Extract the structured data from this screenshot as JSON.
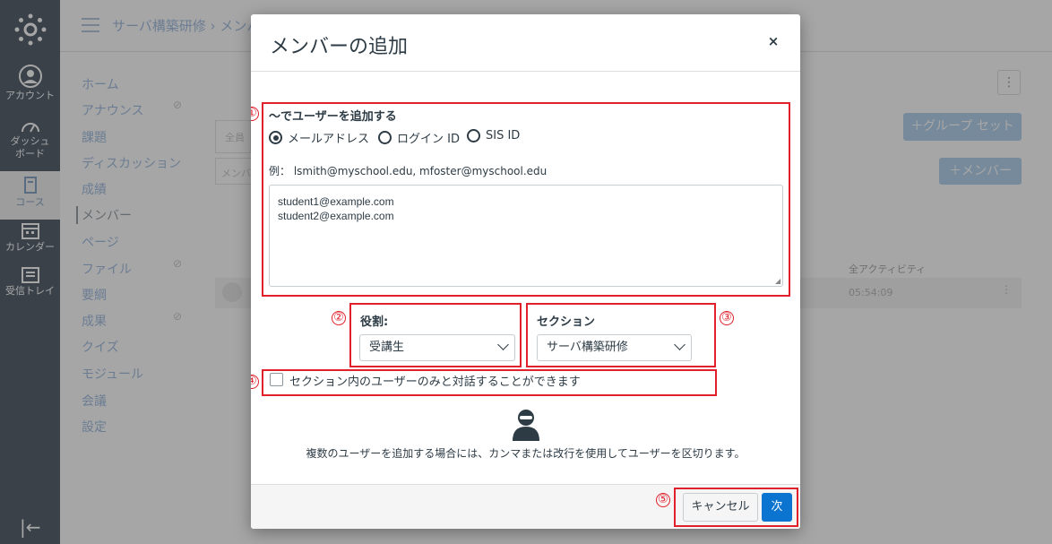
{
  "global_nav": {
    "items": [
      {
        "label": "アカウント",
        "icon": "user-avatar-icon"
      },
      {
        "label": "ダッシュボード",
        "icon": "dashboard-gauge-icon"
      },
      {
        "label": "コース",
        "icon": "book-icon"
      },
      {
        "label": "カレンダー",
        "icon": "calendar-icon"
      },
      {
        "label": "受信トレイ",
        "icon": "inbox-icon"
      }
    ],
    "dash_label_1": "ダッシュ",
    "dash_label_2": "ボード",
    "collapse_glyph": "|←",
    "active_color": "#8aa7c6"
  },
  "page": {
    "breadcrumb": "サーバ構築研修 › メンバー",
    "course_nav": [
      "ホーム",
      "アナウンス",
      "課題",
      "ディスカッション",
      "成績",
      "メンバー",
      "ページ",
      "ファイル",
      "要綱",
      "成果",
      "クイズ",
      "モジュール",
      "会議",
      "設定"
    ],
    "tab_all": "全員",
    "search_placeholder": "メンバ",
    "group_set_button": "＋グループ セット",
    "member_button": "＋メンバー",
    "col_activity": "全アクティビティ",
    "row_time": "05:54:09"
  },
  "modal": {
    "title": "メンバーの追加",
    "close_glyph": "×",
    "add_by_label": "～でユーザーを追加する",
    "radios": [
      {
        "label": "メールアドレス",
        "selected": true
      },
      {
        "label": "ログイン ID",
        "selected": false
      },
      {
        "label": "SIS ID",
        "selected": false
      }
    ],
    "example": "例： lsmith@myschool.edu, mfoster@myschool.edu",
    "textarea_value": "student1@example.com\nstudent2@example.com",
    "role_label": "役割:",
    "role_value": "受講生",
    "section_label": "セクション",
    "section_value": "サーバ構築研修",
    "limit_label": "セクション内のユーザーのみと対話することができます",
    "help_text": "複数のユーザーを追加する場合には、カンマまたは改行を使用してユーザーを区切ります。",
    "cancel_label": "キャンセル",
    "next_label": "次",
    "next_color": "#0b74d0"
  },
  "annotations": {
    "n1": "①",
    "n2": "②",
    "n3": "③",
    "n4": "④",
    "n5": "⑤",
    "color": "#e0202a"
  }
}
